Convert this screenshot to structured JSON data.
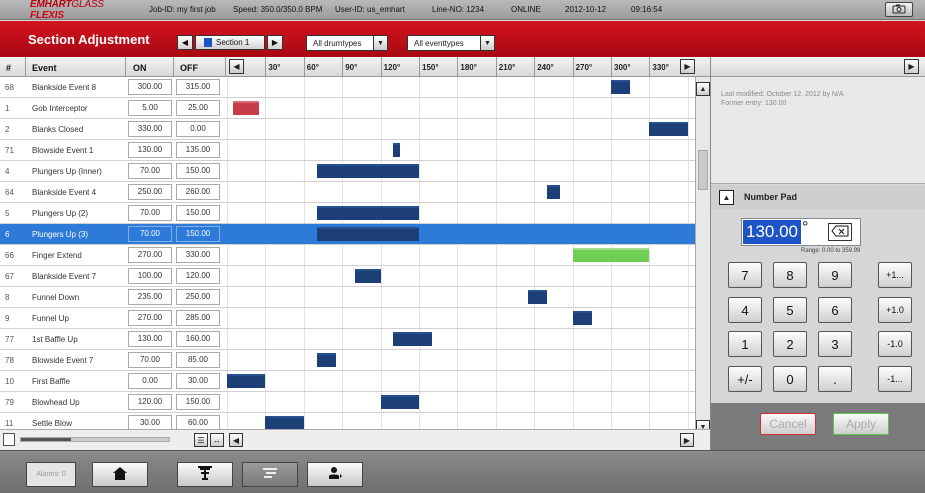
{
  "status_bar": {
    "brand_a": "EMHART",
    "brand_b": "GLASS",
    "brand_c": "FLEXIS",
    "job": "Job-ID: my first job",
    "speed": "Speed: 350.0/350.0 BPM",
    "user": "User-ID: us_emhart",
    "line": "Line-NO: 1234",
    "online": "ONLINE",
    "date": "2012-10-12",
    "time": "09:16:54"
  },
  "title_bar": {
    "title": "Section Adjustment",
    "section": "Section 1",
    "drumtypes": "All drumtypes",
    "eventtypes": "All eventtypes"
  },
  "table": {
    "headers": {
      "num": "#",
      "event": "Event",
      "on": "ON",
      "off": "OFF"
    },
    "degree_labels": [
      "30°",
      "60°",
      "90°",
      "120°",
      "150°",
      "180°",
      "210°",
      "240°",
      "270°",
      "300°",
      "330°"
    ],
    "rows": [
      {
        "num": "68",
        "event": "Blankside Event 8",
        "on": "300.00",
        "off": "315.00",
        "color": "navy"
      },
      {
        "num": "1",
        "event": "Gob Interceptor",
        "on": "5.00",
        "off": "25.00",
        "color": "red"
      },
      {
        "num": "2",
        "event": "Blanks Closed",
        "on": "330.00",
        "off": "0.00",
        "color": "navy"
      },
      {
        "num": "71",
        "event": "Blowside Event 1",
        "on": "130.00",
        "off": "135.00",
        "color": "navy"
      },
      {
        "num": "4",
        "event": "Plungers Up (Inner)",
        "on": "70.00",
        "off": "150.00",
        "color": "navy"
      },
      {
        "num": "64",
        "event": "Blankside Event 4",
        "on": "250.00",
        "off": "260.00",
        "color": "navy"
      },
      {
        "num": "5",
        "event": "Plungers Up (2)",
        "on": "70.00",
        "off": "150.00",
        "color": "navy"
      },
      {
        "num": "6",
        "event": "Plungers Up (3)",
        "on": "70.00",
        "off": "150.00",
        "color": "navy",
        "selected": true
      },
      {
        "num": "66",
        "event": "Finger Extend",
        "on": "270.00",
        "off": "330.00",
        "color": "green"
      },
      {
        "num": "67",
        "event": "Blankside Event 7",
        "on": "100.00",
        "off": "120.00",
        "color": "navy"
      },
      {
        "num": "8",
        "event": "Funnel Down",
        "on": "235.00",
        "off": "250.00",
        "color": "navy"
      },
      {
        "num": "9",
        "event": "Funnel Up",
        "on": "270.00",
        "off": "285.00",
        "color": "navy"
      },
      {
        "num": "77",
        "event": "1st Baffle Up",
        "on": "130.00",
        "off": "160.00",
        "color": "navy"
      },
      {
        "num": "78",
        "event": "Blowside Event 7",
        "on": "70.00",
        "off": "85.00",
        "color": "navy"
      },
      {
        "num": "10",
        "event": "First Baffle",
        "on": "0.00",
        "off": "30.00",
        "color": "navy"
      },
      {
        "num": "79",
        "event": "Blowhead Up",
        "on": "120.00",
        "off": "150.00",
        "color": "navy"
      },
      {
        "num": "11",
        "event": "Settle Blow",
        "on": "30.00",
        "off": "60.00",
        "color": "navy"
      }
    ]
  },
  "info": {
    "last_modified": "Last modified:  October 12, 2012  by  N/A",
    "former_entry": "Former entry:   130.00"
  },
  "numpad": {
    "title": "Number Pad",
    "value": "130.00",
    "degree": "°",
    "range": "Range: 0.00 to 359.99",
    "keys": [
      "7",
      "8",
      "9",
      "4",
      "5",
      "6",
      "1",
      "2",
      "3",
      "+/-",
      "0",
      "."
    ],
    "side_keys": [
      "+1...",
      "+1.0",
      "-1.0",
      "-1..."
    ],
    "cancel": "Cancel",
    "apply": "Apply"
  },
  "toolbar": {
    "alarms": "Alarms: 0"
  },
  "colors": {
    "navy": "#1c3f78",
    "red": "#c83c4a",
    "green": "#6fcf54",
    "selected": "#2d7ad8",
    "title_red": "#c40d18"
  }
}
